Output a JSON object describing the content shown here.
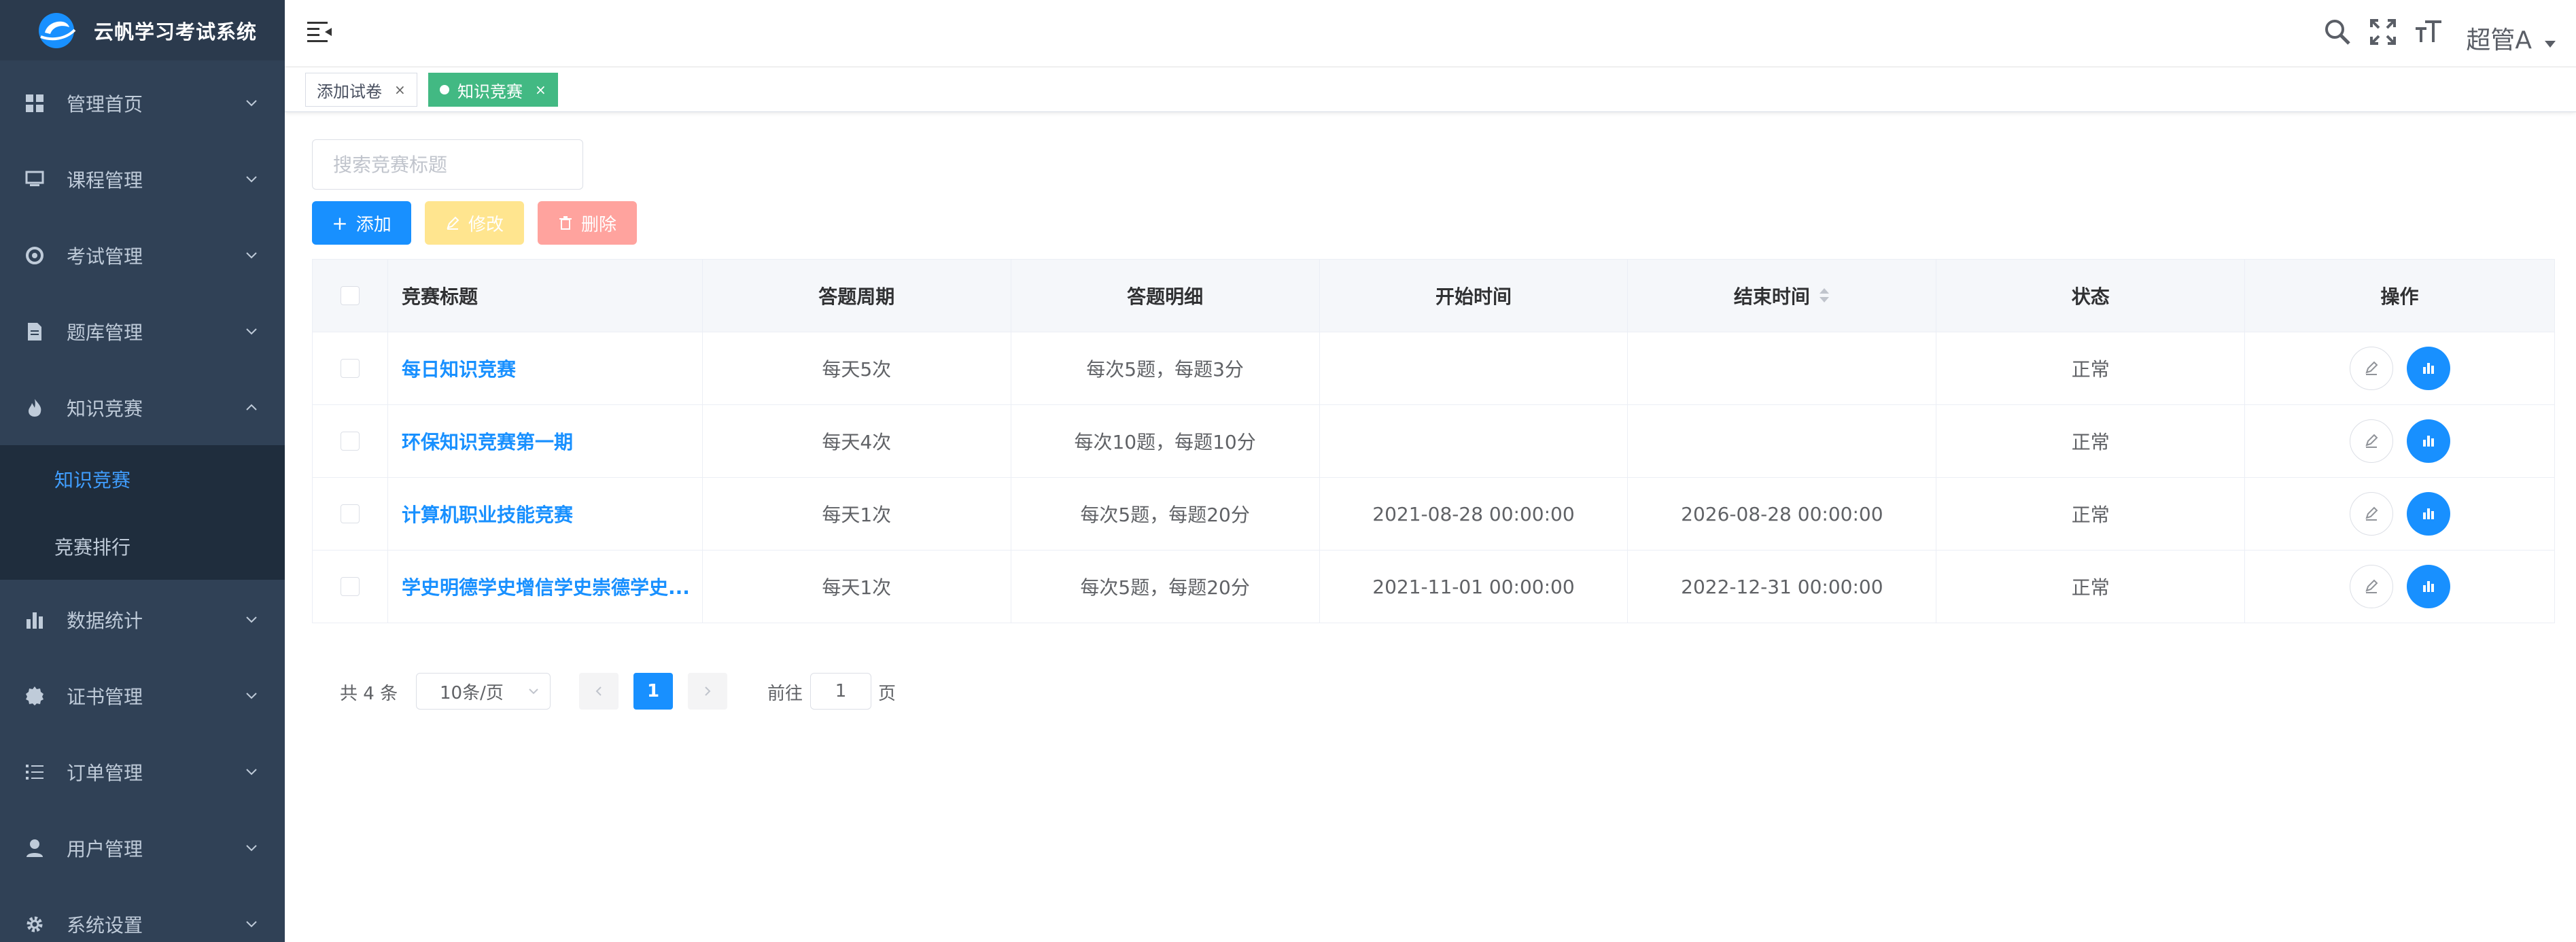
{
  "app": {
    "title": "云帆学习考试系统"
  },
  "sidebar": {
    "items": [
      {
        "label": "管理首页",
        "icon": "dashboard-icon"
      },
      {
        "label": "课程管理",
        "icon": "course-icon"
      },
      {
        "label": "考试管理",
        "icon": "exam-icon"
      },
      {
        "label": "题库管理",
        "icon": "question-bank-icon"
      },
      {
        "label": "知识竞赛",
        "icon": "fire-icon",
        "expanded": true
      },
      {
        "label": "数据统计",
        "icon": "bar-chart-icon"
      },
      {
        "label": "证书管理",
        "icon": "certificate-icon"
      },
      {
        "label": "订单管理",
        "icon": "order-list-icon"
      },
      {
        "label": "用户管理",
        "icon": "user-icon"
      },
      {
        "label": "系统设置",
        "icon": "gear-icon"
      }
    ],
    "submenu": [
      {
        "label": "知识竞赛",
        "active": true
      },
      {
        "label": "竞赛排行",
        "active": false
      }
    ]
  },
  "header": {
    "user": "超管A"
  },
  "tags": [
    {
      "label": "添加试卷",
      "active": false
    },
    {
      "label": "知识竞赛",
      "active": true
    }
  ],
  "search": {
    "placeholder": "搜索竞赛标题"
  },
  "toolbar": {
    "add": "添加",
    "edit": "修改",
    "delete": "删除"
  },
  "table": {
    "headers": [
      "竞赛标题",
      "答题周期",
      "答题明细",
      "开始时间",
      "结束时间",
      "状态",
      "操作"
    ],
    "rows": [
      {
        "title": "每日知识竞赛",
        "cycle": "每天5次",
        "detail": "每次5题，每题3分",
        "start": "",
        "end": "",
        "status": "正常"
      },
      {
        "title": "环保知识竞赛第一期",
        "cycle": "每天4次",
        "detail": "每次10题，每题10分",
        "start": "",
        "end": "",
        "status": "正常"
      },
      {
        "title": "计算机职业技能竞赛",
        "cycle": "每天1次",
        "detail": "每次5题，每题20分",
        "start": "2021-08-28 00:00:00",
        "end": "2026-08-28 00:00:00",
        "status": "正常"
      },
      {
        "title": "学史明德学史增信学史崇德学史...",
        "cycle": "每天1次",
        "detail": "每次5题，每题20分",
        "start": "2021-11-01 00:00:00",
        "end": "2022-12-31 00:00:00",
        "status": "正常"
      }
    ]
  },
  "pagination": {
    "total": "共 4 条",
    "page_size": "10条/页",
    "current": "1",
    "goto_prefix": "前往",
    "goto_value": "1",
    "goto_suffix": "页"
  },
  "colors": {
    "sidebar_bg": "#304156",
    "primary": "#1890ff",
    "tag_active": "#42b983"
  }
}
